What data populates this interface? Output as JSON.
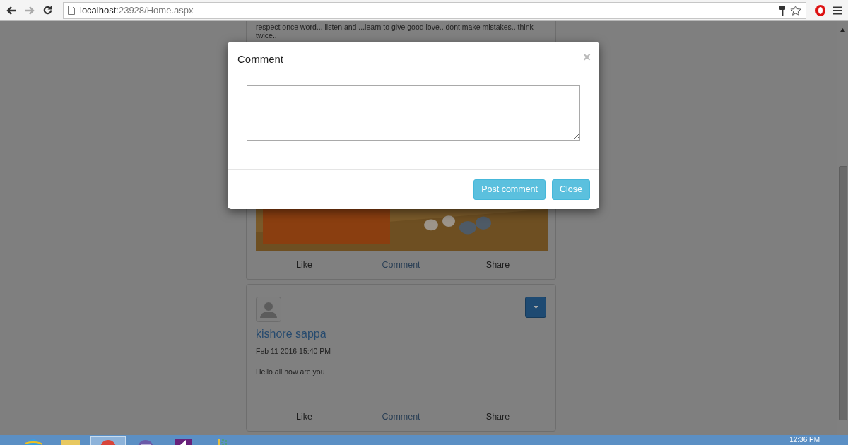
{
  "browser": {
    "url_host": "localhost",
    "url_rest": ":23928/Home.aspx"
  },
  "posts": [
    {
      "text": "respect once word... listen and ...learn to give good love.. dont make mistakes.. think twice..",
      "actions": [
        {
          "label": "Like",
          "kind": "plain"
        },
        {
          "label": "Comment",
          "kind": "link"
        },
        {
          "label": "Share",
          "kind": "plain"
        }
      ]
    },
    {
      "kind": "status",
      "author": "kishore sappa",
      "date": "Feb 11 2016 15:40 PM",
      "text": "Hello all how are you",
      "actions": [
        {
          "label": "Like",
          "kind": "plain"
        },
        {
          "label": "Comment",
          "kind": "link"
        },
        {
          "label": "Share",
          "kind": "plain"
        }
      ]
    }
  ],
  "modal": {
    "title": "Comment",
    "close": "×",
    "buttons": [
      "Post comment",
      "Close"
    ]
  },
  "taskbar": {
    "apps": [
      {
        "kind": "ie",
        "selected": false
      },
      {
        "kind": "folder",
        "selected": false
      },
      {
        "kind": "chrome",
        "selected": true
      },
      {
        "kind": "eclipse",
        "selected": false
      },
      {
        "kind": "studio",
        "selected": false
      },
      {
        "kind": "tool",
        "selected": false
      }
    ],
    "clock": "12:36 PM"
  }
}
